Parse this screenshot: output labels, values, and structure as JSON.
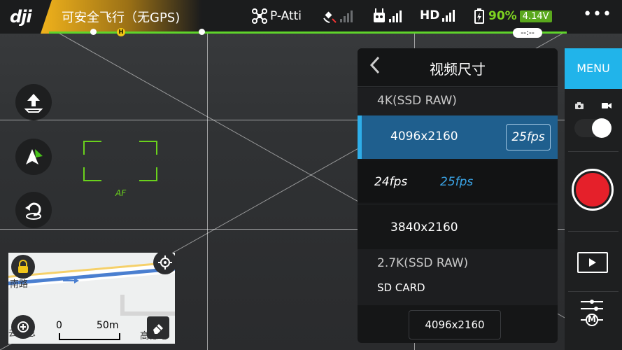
{
  "status_bar": {
    "logo": "dji",
    "flight_status": "可安全飞行（无GPS)",
    "flight_mode": "P-Atti",
    "hd_label": "HD",
    "battery_percent": "90%",
    "battery_voltage": "4.14V",
    "more_label": "•••",
    "home_marker": "H",
    "timer": "--:--"
  },
  "camera_view": {
    "af_label": "AF"
  },
  "map": {
    "text_south_road": "南路",
    "text_info": "去位息",
    "text_hd_map": "高德地图",
    "scale_start": "0",
    "scale_end": "50m"
  },
  "video_size_panel": {
    "title": "视频尺寸",
    "back_label": "<",
    "sections": [
      {
        "header": "4K(SSD RAW)",
        "options": [
          {
            "resolution": "4096x2160",
            "fps": "25fps",
            "selected": true
          },
          {
            "fps_options": [
              "24fps",
              "25fps"
            ],
            "selected_fps": "25fps"
          },
          {
            "resolution": "3840x2160",
            "selected": false
          }
        ]
      },
      {
        "header": "2.7K(SSD RAW)"
      }
    ],
    "sd_card_label": "SD CARD",
    "sd_card_resolution": "4096x2160"
  },
  "right_rail": {
    "menu_label": "MENU",
    "photo_icon": "camera-icon",
    "video_icon": "video-icon",
    "mode_toggle": "video",
    "m_label": "M"
  },
  "colors": {
    "accent_blue": "#21b4ea",
    "selected_row": "#1f5f8e",
    "record_red": "#e5202a",
    "af_green": "#6ad21c",
    "battery_green": "#7ed321",
    "status_amber": "#f0b21c"
  }
}
